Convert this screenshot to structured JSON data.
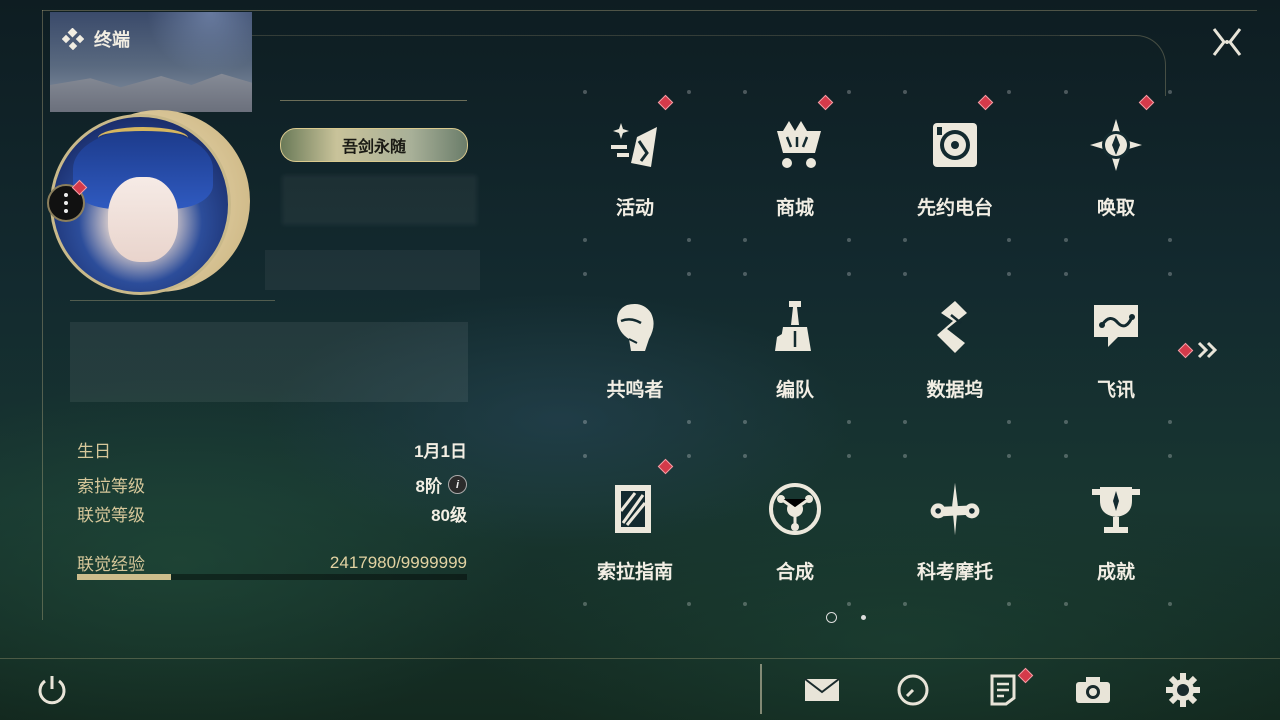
{
  "header": {
    "title": "终端"
  },
  "profile": {
    "title_badge": "吾剑永随",
    "stats": [
      {
        "label": "生日",
        "value": "1月1日"
      },
      {
        "label": "索拉等级",
        "value": "8阶"
      },
      {
        "label": "联觉等级",
        "value": "80级"
      }
    ],
    "exp": {
      "label": "联觉经验",
      "value": "2417980/9999999",
      "progress": 0.242
    }
  },
  "menu": [
    {
      "label": "活动",
      "icon": "activity-icon",
      "badge": true
    },
    {
      "label": "商城",
      "icon": "shop-cart-icon",
      "badge": true
    },
    {
      "label": "先约电台",
      "icon": "radio-icon",
      "badge": true
    },
    {
      "label": "唤取",
      "icon": "summon-compass-icon",
      "badge": true
    },
    {
      "label": "共鸣者",
      "icon": "resonator-icon",
      "badge": false
    },
    {
      "label": "编队",
      "icon": "chess-team-icon",
      "badge": false
    },
    {
      "label": "数据坞",
      "icon": "data-dock-icon",
      "badge": false
    },
    {
      "label": "飞讯",
      "icon": "chat-icon",
      "badge": false
    },
    {
      "label": "索拉指南",
      "icon": "guide-icon",
      "badge": true
    },
    {
      "label": "合成",
      "icon": "synthesis-icon",
      "badge": false
    },
    {
      "label": "科考摩托",
      "icon": "motorcycle-icon",
      "badge": false
    },
    {
      "label": "成就",
      "icon": "trophy-icon",
      "badge": false
    }
  ],
  "pagination": {
    "current": 1,
    "total": 2
  },
  "bottom_bar": [
    "power-icon",
    "mail-icon",
    "clock-icon",
    "notes-icon",
    "camera-icon",
    "settings-icon"
  ],
  "colors": {
    "accent": "#d6c79a",
    "badge": "#d43a4a",
    "background": "#13291f"
  }
}
